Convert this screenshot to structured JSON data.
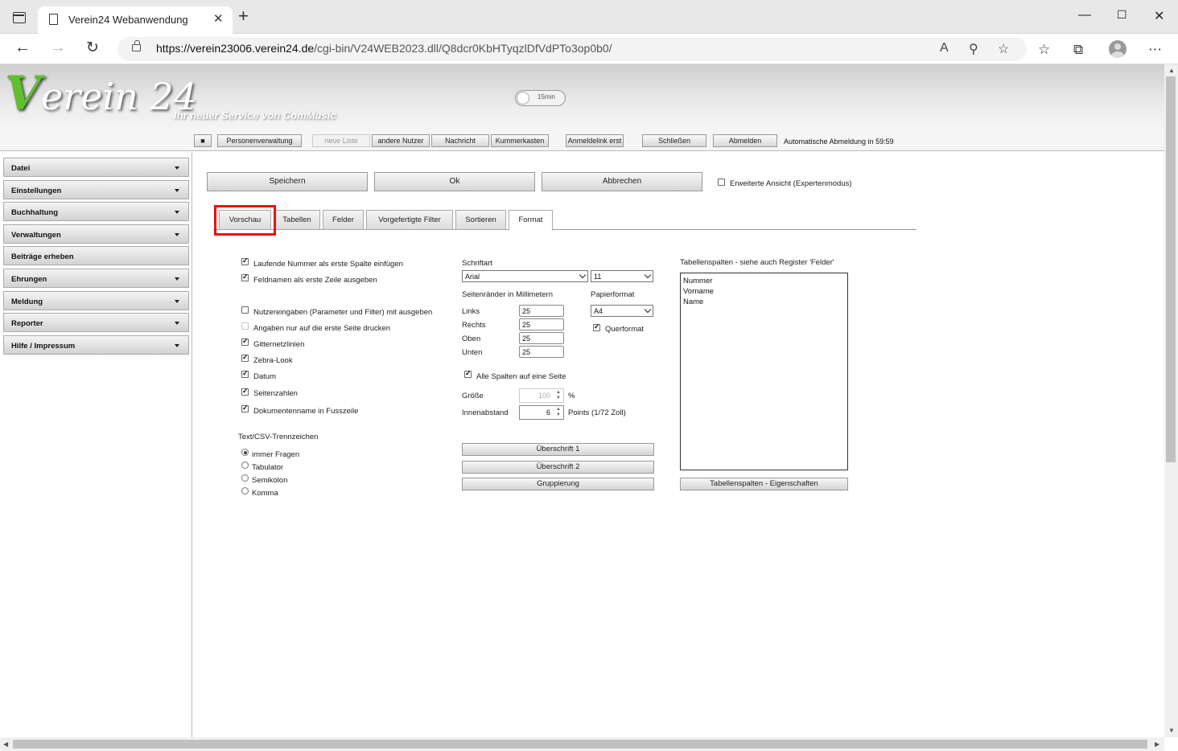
{
  "browser": {
    "tab_title": "Verein24 Webanwendung",
    "url_host": "https://verein23006.verein24.de",
    "url_path": "/cgi-bin/V24WEB2023.dll/Q8dcr0KbHTyqzlDfVdPTo3op0b0/"
  },
  "header": {
    "logo_v": "V",
    "logo_rest": "erein 24",
    "tagline": "Ihr neuer Service von ComMusic",
    "timer_label": "15min"
  },
  "toolbar": {
    "square_label": "■",
    "personen": "Personenverwaltung",
    "neue_liste": "neue Liste",
    "andere_nutzer": "andere Nutzer",
    "nachricht": "Nachricht",
    "kummerkasten": "Kummerkasten",
    "anmeldelink": "Anmeldelink erst",
    "schliessen": "Schließen",
    "abmelden": "Abmelden",
    "logout_info": "Automatische Abmeldung in 59:59"
  },
  "sidebar": {
    "items": [
      {
        "label": "Datei",
        "caret": true
      },
      {
        "label": "Einstellungen",
        "caret": true
      },
      {
        "label": "Buchhaltung",
        "caret": true
      },
      {
        "label": "Verwaltungen",
        "caret": true
      },
      {
        "label": "Beiträge erheben",
        "caret": false
      },
      {
        "label": "Ehrungen",
        "caret": true
      },
      {
        "label": "Meldung",
        "caret": true
      },
      {
        "label": "Reporter",
        "caret": true
      },
      {
        "label": "Hilfe / Impressum",
        "caret": true
      }
    ]
  },
  "actions": {
    "speichern": "Speichern",
    "ok": "Ok",
    "abbrechen": "Abbrechen",
    "expert_mode": "Erweiterte Ansicht (Expertenmodus)"
  },
  "tabs": {
    "vorschau": "Vorschau",
    "tabellen": "Tabellen",
    "felder": "Felder",
    "filter": "Vorgefertigte Filter",
    "sortieren": "Sortieren",
    "format": "Format"
  },
  "options": {
    "laufende_nummer": "Laufende Nummer als erste Spalte einfügen",
    "feldnamen": "Feldnamen als erste Zeile ausgeben",
    "nutzereingaben": "Nutzereingaben (Parameter und Filter) mit ausgeben",
    "erste_seite": "Angaben nur auf die erste Seite drucken",
    "gitternetz": "Gitternetzlinien",
    "zebra": "Zebra-Look",
    "datum": "Datum",
    "seitenzahlen": "Seitenzahlen",
    "dokumentenname": "Dokumentenname in Fusszeile"
  },
  "csv": {
    "heading": "Text/CSV-Trennzeichen",
    "immer": "immer Fragen",
    "tabulator": "Tabulator",
    "semikolon": "Semikolon",
    "komma": "Komma"
  },
  "font": {
    "heading": "Schriftart",
    "family": "Arial",
    "size": "11"
  },
  "margins": {
    "heading": "Seitenränder in Millimetern",
    "links_label": "Links",
    "links": "25",
    "rechts_label": "Rechts",
    "rechts": "25",
    "oben_label": "Oben",
    "oben": "25",
    "unten_label": "Unten",
    "unten": "25"
  },
  "paper": {
    "heading": "Papierformat",
    "format": "A4",
    "querformat": "Querformat"
  },
  "scaling": {
    "alle_spalten": "Alle Spalten auf eine Seite",
    "groesse_label": "Größe",
    "groesse": "100",
    "percent": "%",
    "innen_label": "Innenabstand",
    "innen": "6",
    "points": "Points (1/72 Zoll)"
  },
  "buttons": {
    "ueberschrift1": "Überschrift 1",
    "ueberschrift2": "Überschrift 2",
    "gruppierung": "Gruppierung",
    "spalten_eigenschaften": "Tabellenspalten - Eigenschaften"
  },
  "columns": {
    "heading": "Tabellenspalten - siehe auch Register 'Felder'",
    "items": [
      "Nummer",
      "Vorname",
      "Name"
    ]
  }
}
